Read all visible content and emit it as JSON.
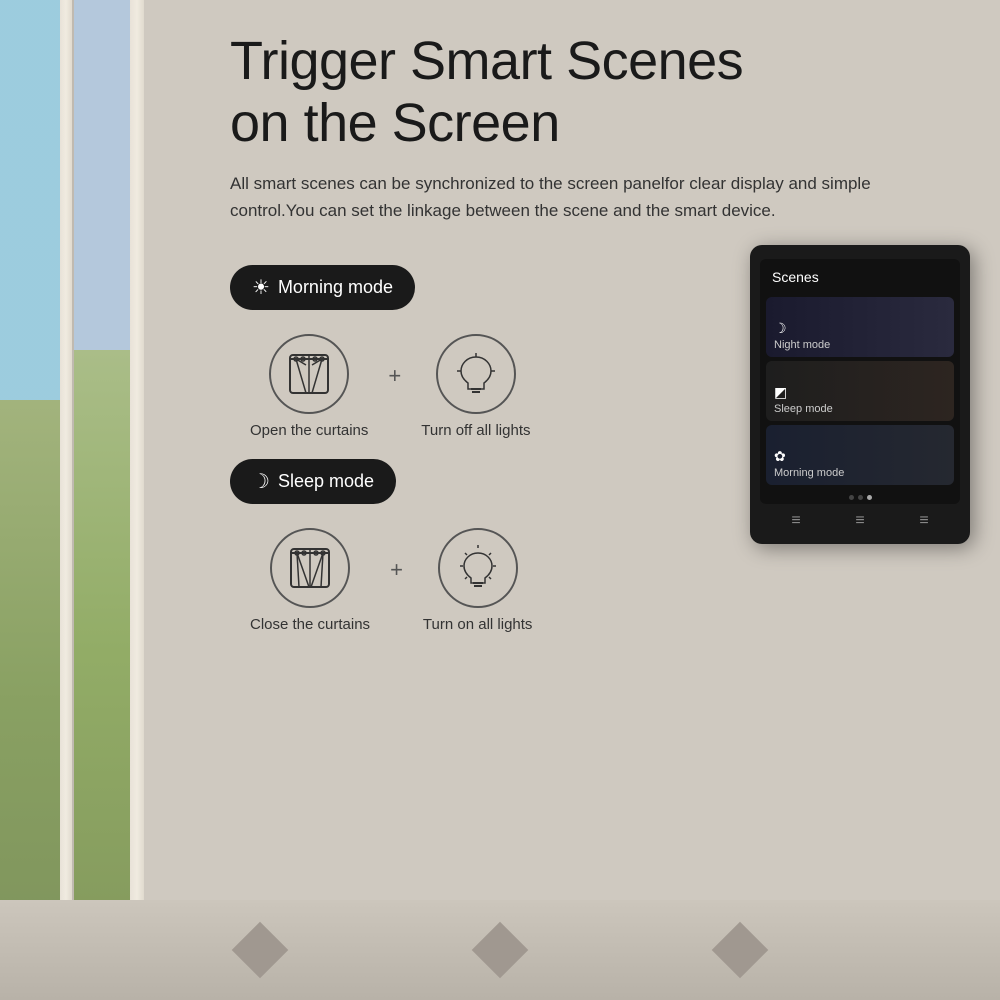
{
  "page": {
    "title": "Trigger Smart Scenes on the Screen",
    "title_line1": "Trigger Smart Scenes",
    "title_line2": "on the Screen",
    "subtitle": "All smart scenes can be synchronized to the screen panelfor clear display and simple control.You can set the linkage between the scene and the smart device."
  },
  "modes": [
    {
      "id": "morning",
      "label": "Morning mode",
      "icon": "☀",
      "actions": [
        {
          "id": "open-curtains",
          "label": "Open the curtains",
          "type": "curtains-open"
        },
        {
          "id": "turn-off-lights",
          "label": "Turn off all lights",
          "type": "light-off"
        }
      ]
    },
    {
      "id": "sleep",
      "label": "Sleep mode",
      "icon": "☽",
      "actions": [
        {
          "id": "close-curtains",
          "label": "Close the curtains",
          "type": "curtains-close"
        },
        {
          "id": "turn-on-lights",
          "label": "Turn on all lights",
          "type": "light-on"
        }
      ]
    }
  ],
  "device": {
    "screen_title": "Scenes",
    "scenes": [
      {
        "id": "night",
        "label": "Night mode",
        "icon": "☽"
      },
      {
        "id": "sleep",
        "label": "Sleep mode",
        "icon": "◩"
      },
      {
        "id": "morning",
        "label": "Morning mode",
        "icon": "✿"
      }
    ],
    "dots": [
      false,
      false,
      true
    ],
    "bottom_buttons": [
      "≡",
      "≡",
      "≡"
    ]
  },
  "colors": {
    "pill_bg": "#1a1a1a",
    "pill_text": "#ffffff",
    "wall_bg": "#cfc9c0",
    "device_bg": "#1a1a1a"
  }
}
